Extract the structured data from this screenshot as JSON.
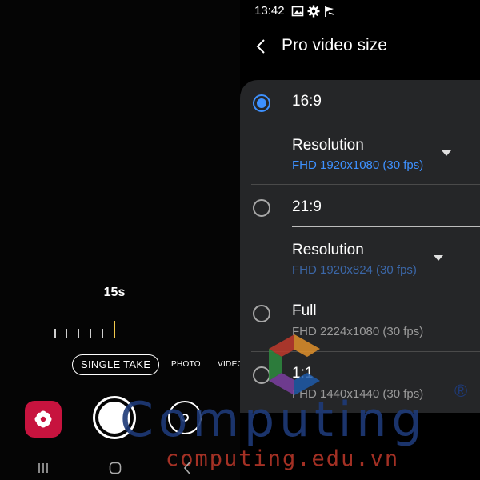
{
  "status_bar": {
    "time": "13:42",
    "icons": [
      "image-icon",
      "gear-icon",
      "flag-icon"
    ]
  },
  "camera": {
    "timer": "15s",
    "timeline_selected_fraction": 1.0,
    "modes": [
      {
        "label": "SINGLE TAKE",
        "selected": true
      },
      {
        "label": "PHOTO",
        "selected": false
      },
      {
        "label": "VIDEO",
        "selected": false
      }
    ],
    "gallery_color": "#c7133e"
  },
  "settings": {
    "title": "Pro video size",
    "accent_color": "#3e91ff",
    "options": [
      {
        "label": "16:9",
        "checked": true,
        "resolution_label": "Resolution",
        "resolution_value": "FHD 1920x1080 (30 fps)"
      },
      {
        "label": "21:9",
        "checked": false,
        "resolution_label": "Resolution",
        "resolution_value": "FHD 1920x824 (30 fps)"
      },
      {
        "label": "Full",
        "checked": false,
        "detail": "FHD 2224x1080 (30 fps)"
      },
      {
        "label": "1:1",
        "checked": false,
        "detail": "FHD 1440x1440 (30 fps)"
      }
    ]
  },
  "watermark": {
    "brand": "Computing",
    "registered": "®",
    "url": "computing.edu.vn"
  }
}
